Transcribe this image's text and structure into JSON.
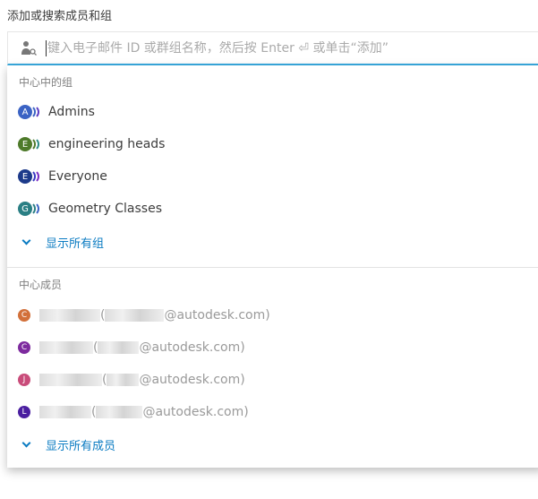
{
  "label": "添加或搜索成员和组",
  "search": {
    "placeholder": "键入电子邮件 ID 或群组名称，然后按 Enter ⏎ 或单击“添加”",
    "value": ""
  },
  "groups": {
    "heading": "中心中的组",
    "items": [
      {
        "initial": "A",
        "name": "Admins",
        "color": "#3b63c4"
      },
      {
        "initial": "E",
        "name": "engineering heads",
        "color": "#4e7a2a"
      },
      {
        "initial": "E",
        "name": "Everyone",
        "color": "#1d3a8a"
      },
      {
        "initial": "G",
        "name": "Geometry Classes",
        "color": "#2a7f84"
      }
    ],
    "show_all": "显示所有组"
  },
  "members": {
    "heading": "中心成员",
    "items": [
      {
        "initial": "C",
        "color": "#d2703a",
        "open": "(",
        "domain": "@autodesk.com)"
      },
      {
        "initial": "C",
        "color": "#7d2a9e",
        "open": "(",
        "domain": "@autodesk.com)"
      },
      {
        "initial": "J",
        "color": "#c94c7a",
        "open": "(",
        "domain": "@autodesk.com)"
      },
      {
        "initial": "L",
        "color": "#4a1ea0",
        "open": "(",
        "domain": "@autodesk.com)"
      }
    ],
    "show_all": "显示所有成员"
  }
}
